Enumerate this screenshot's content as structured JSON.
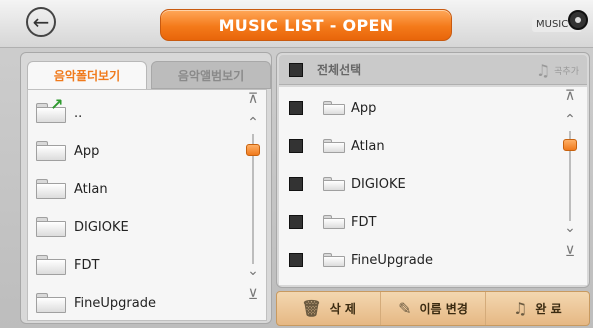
{
  "header": {
    "back_icon": "back-arrow-circle-icon",
    "title": "MUSIC LIST - OPEN",
    "music_badge": "MUSIC"
  },
  "left_panel": {
    "tabs": [
      {
        "label": "음악폴더보기",
        "active": true
      },
      {
        "label": "음악앨범보기",
        "active": false
      }
    ],
    "items": [
      {
        "label": "..",
        "icon": "folder-up-icon"
      },
      {
        "label": "App",
        "icon": "folder-icon"
      },
      {
        "label": "Atlan",
        "icon": "folder-icon"
      },
      {
        "label": "DIGIOKE",
        "icon": "folder-icon"
      },
      {
        "label": "FDT",
        "icon": "folder-icon"
      },
      {
        "label": "FineUpgrade",
        "icon": "folder-icon"
      }
    ]
  },
  "right_panel": {
    "select_all_label": "전체선택",
    "add_song_label": "곡추가",
    "items": [
      {
        "label": "App"
      },
      {
        "label": "Atlan"
      },
      {
        "label": "DIGIOKE"
      },
      {
        "label": "FDT"
      },
      {
        "label": "FineUpgrade"
      }
    ]
  },
  "actions": {
    "delete_label": "삭 제",
    "rename_label": "이름 변경",
    "done_label": "완 료"
  },
  "colors": {
    "accent": "#f47a1a",
    "active_tab_text": "#f07a1c"
  }
}
